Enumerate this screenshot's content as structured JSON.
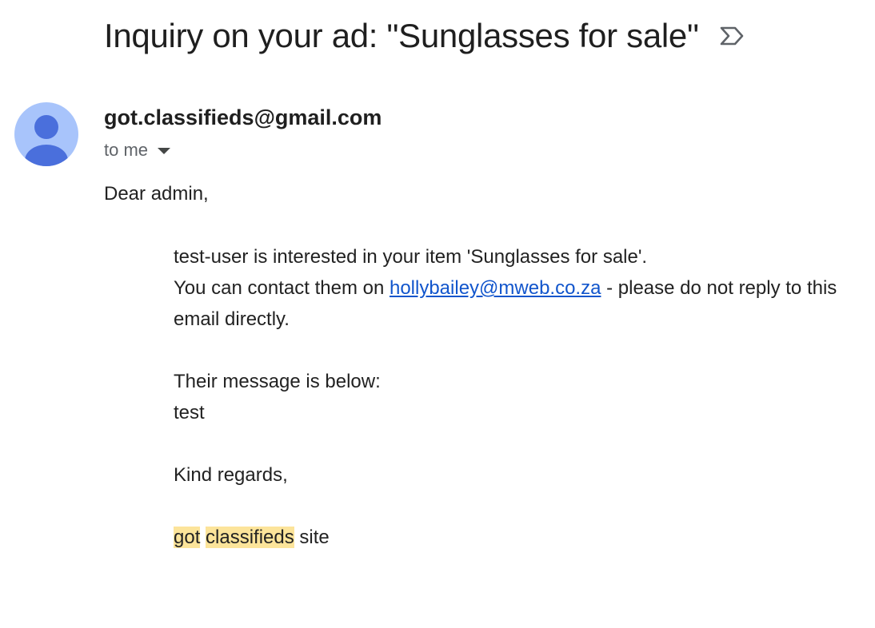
{
  "email": {
    "subject": "Inquiry on your ad: \"Sunglasses for sale\"",
    "label_icon": "label-arrow-icon",
    "sender": {
      "address": "got.classifieds@gmail.com",
      "avatar_icon": "default-avatar-icon",
      "avatar_color": "#a8c4fb",
      "avatar_figure_color": "#4a6fdc"
    },
    "recipients": "to me",
    "body": {
      "greeting": "Dear admin,",
      "line1": "test-user is interested in your item 'Sunglasses for sale'.",
      "line2_prefix": "You can contact them on ",
      "contact_link": "hollybailey@mweb.co.za",
      "line2_suffix": " - please do not reply to this email directly.",
      "message_intro": "Their message is below:",
      "message": "test",
      "closing": "Kind regards,",
      "signature_word1": "got",
      "signature_word2": "classifieds",
      "signature_word3": " site"
    },
    "colors": {
      "link": "#1155cc",
      "highlight": "#fce49a"
    }
  }
}
